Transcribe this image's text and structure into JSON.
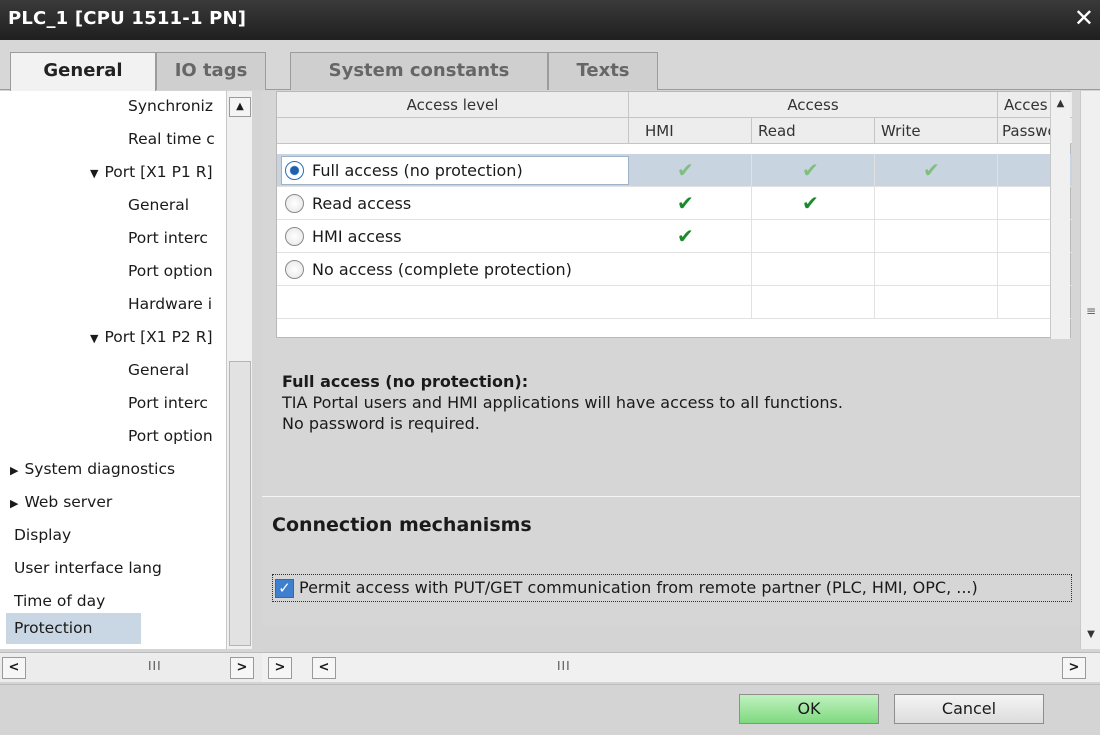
{
  "window": {
    "title": "PLC_1 [CPU 1511-1 PN]",
    "close_glyph": "✕"
  },
  "tabs": [
    {
      "label": "General",
      "active": true
    },
    {
      "label": "IO tags",
      "active": false
    },
    {
      "label": "System constants",
      "active": false
    },
    {
      "label": "Texts",
      "active": false
    }
  ],
  "nav": {
    "items": [
      {
        "label": "Synchroniz",
        "arrow": ""
      },
      {
        "label": "Real time c",
        "arrow": ""
      },
      {
        "label": "Port [X1 P1 R]",
        "arrow": "▼"
      },
      {
        "label": "General",
        "arrow": ""
      },
      {
        "label": "Port interc",
        "arrow": ""
      },
      {
        "label": "Port option",
        "arrow": ""
      },
      {
        "label": "Hardware i",
        "arrow": ""
      },
      {
        "label": "Port [X1 P2 R]",
        "arrow": "▼"
      },
      {
        "label": "General",
        "arrow": ""
      },
      {
        "label": "Port interc",
        "arrow": ""
      },
      {
        "label": "Port option",
        "arrow": ""
      },
      {
        "label": "System diagnostics",
        "arrow": "▶"
      },
      {
        "label": "Web server",
        "arrow": "▶"
      },
      {
        "label": "Display",
        "arrow": ""
      },
      {
        "label": "User interface lang",
        "arrow": ""
      },
      {
        "label": "Time of day",
        "arrow": ""
      },
      {
        "label": "Protection",
        "arrow": "",
        "selected": true
      }
    ]
  },
  "grid": {
    "headers_top": {
      "access_level": "Access level",
      "access": "Access",
      "access_cut": "Acces"
    },
    "headers_sub": {
      "hmi": "HMI",
      "read": "Read",
      "write": "Write",
      "password": "Passwc"
    },
    "rows": [
      {
        "label": "Full access (no protection)",
        "selected": true,
        "hmi": true,
        "read": true,
        "write": true
      },
      {
        "label": "Read access",
        "selected": false,
        "hmi": true,
        "read": true,
        "write": false
      },
      {
        "label": "HMI access",
        "selected": false,
        "hmi": true,
        "read": false,
        "write": false
      },
      {
        "label": "No access (complete protection)",
        "selected": false,
        "hmi": false,
        "read": false,
        "write": false
      }
    ],
    "check_glyph": "✔"
  },
  "info": {
    "title": "Full access (no protection):",
    "line1": "TIA Portal users and HMI applications will have access to all functions.",
    "line2": "No password is required."
  },
  "connection": {
    "title": "Connection mechanisms",
    "permit_label": "Permit access with PUT/GET communication from remote partner (PLC, HMI, OPC, ...)",
    "permit_checked": true
  },
  "scroll": {
    "up": "▲",
    "down": "▼",
    "left": "<",
    "right": ">",
    "grip": "III",
    "vgrip": "≡"
  },
  "footer": {
    "ok_label": "OK",
    "cancel_label": "Cancel"
  }
}
